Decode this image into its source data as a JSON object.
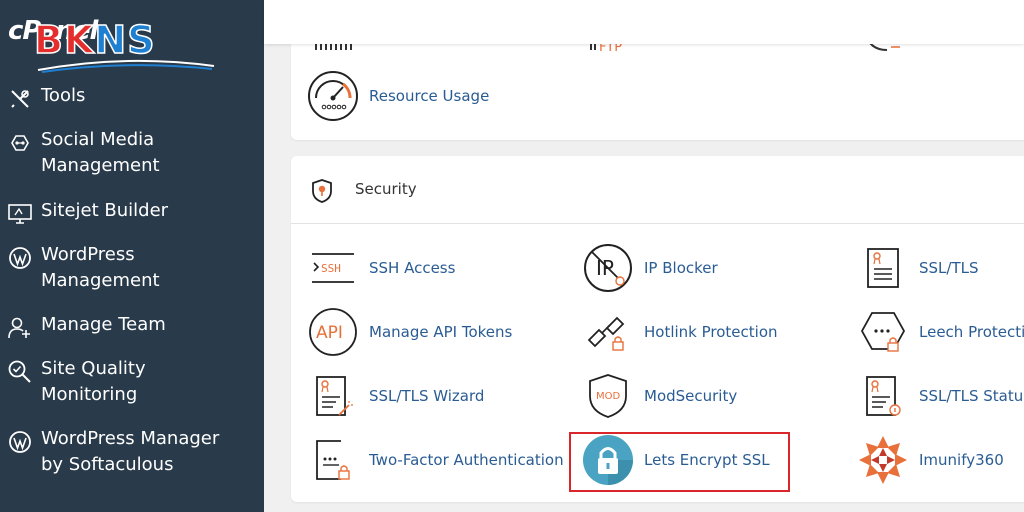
{
  "sidebar": {
    "logo": {
      "cpanel_text": "cPanel",
      "brand_part1": "BK",
      "brand_part2": "NS"
    },
    "items": [
      {
        "label": "Tools",
        "icon": "tools-icon"
      },
      {
        "label": "Social Media\nManagement",
        "icon": "social-media-icon"
      },
      {
        "label": "Sitejet Builder",
        "icon": "sitejet-icon"
      },
      {
        "label": "WordPress\nManagement",
        "icon": "wordpress-icon"
      },
      {
        "label": "Manage Team",
        "icon": "manage-team-icon"
      },
      {
        "label": "Site Quality\nMonitoring",
        "icon": "site-quality-icon"
      },
      {
        "label": "WordPress Manager\nby Softaculous",
        "icon": "wordpress-icon"
      }
    ]
  },
  "metrics_panel": {
    "partial_icon_text": "FTP",
    "items": [
      {
        "label": "Resource Usage",
        "icon": "resource-usage-icon"
      }
    ]
  },
  "security": {
    "title": "Security",
    "items": [
      {
        "label": "SSH Access",
        "icon": "ssh-icon",
        "icon_text": "SSH"
      },
      {
        "label": "IP Blocker",
        "icon": "ip-blocker-icon",
        "icon_text": "IP"
      },
      {
        "label": "SSL/TLS",
        "icon": "ssl-tls-icon"
      },
      {
        "label": "Manage API Tokens",
        "icon": "api-tokens-icon",
        "icon_text": "API"
      },
      {
        "label": "Hotlink Protection",
        "icon": "hotlink-protection-icon"
      },
      {
        "label": "Leech Protectic",
        "icon": "leech-protection-icon"
      },
      {
        "label": "SSL/TLS Wizard",
        "icon": "ssl-tls-wizard-icon"
      },
      {
        "label": "ModSecurity",
        "icon": "modsecurity-icon",
        "icon_text": "MOD"
      },
      {
        "label": "SSL/TLS Status",
        "icon": "ssl-tls-status-icon"
      },
      {
        "label": "Two-Factor Authentication",
        "icon": "two-factor-icon"
      },
      {
        "label": "Lets Encrypt SSL",
        "icon": "lets-encrypt-icon"
      },
      {
        "label": "Imunify360",
        "icon": "imunify360-icon"
      }
    ]
  },
  "colors": {
    "sidebar_bg": "#293a4a",
    "link": "#2a5c94",
    "accent_orange": "#e8703a",
    "highlight_red": "#d9262a",
    "lets_encrypt_teal": "#4aa3c2"
  }
}
